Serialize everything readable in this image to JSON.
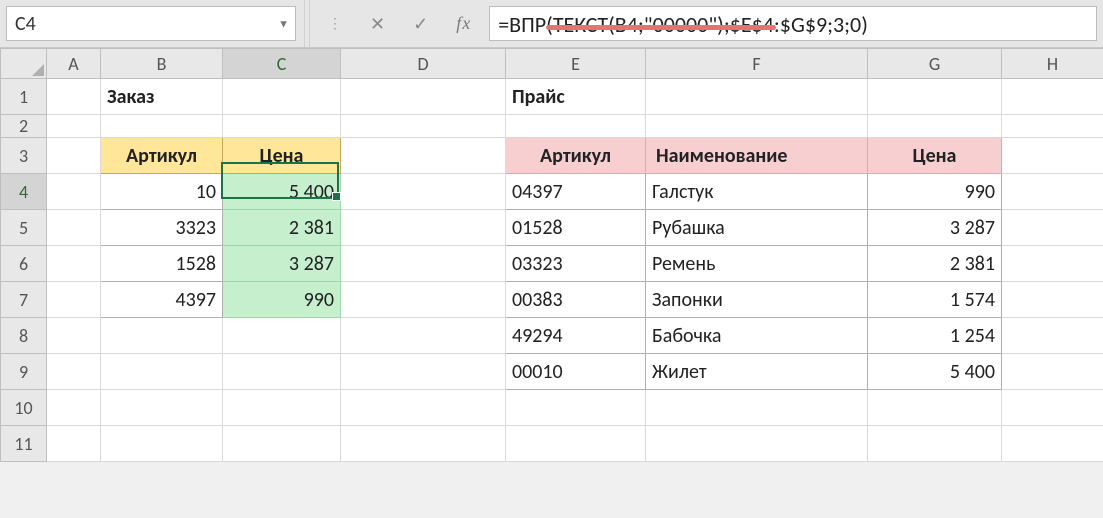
{
  "namebox": {
    "value": "C4"
  },
  "formula_bar": {
    "cancel_glyph": "✕",
    "confirm_glyph": "✓",
    "fx_label": "fx",
    "formula": "=ВПР(ТЕКСТ(B4;\"00000\");$E$4:$G$9;3;0)"
  },
  "columns": [
    "A",
    "B",
    "C",
    "D",
    "E",
    "F",
    "G",
    "H"
  ],
  "rows": [
    "1",
    "2",
    "3",
    "4",
    "5",
    "6",
    "7",
    "8",
    "9",
    "10",
    "11"
  ],
  "titles": {
    "order": "Заказ",
    "price": "Прайс"
  },
  "order_headers": {
    "sku": "Артикул",
    "price": "Цена"
  },
  "order_rows": [
    {
      "sku": "10",
      "price": "5 400"
    },
    {
      "sku": "3323",
      "price": "2 381"
    },
    {
      "sku": "1528",
      "price": "3 287"
    },
    {
      "sku": "4397",
      "price": "990"
    }
  ],
  "price_headers": {
    "sku": "Артикул",
    "name": "Наименование",
    "price": "Цена"
  },
  "price_rows": [
    {
      "sku": "04397",
      "name": "Галстук",
      "price": "990"
    },
    {
      "sku": "01528",
      "name": "Рубашка",
      "price": "3 287"
    },
    {
      "sku": "03323",
      "name": "Ремень",
      "price": "2 381"
    },
    {
      "sku": "00383",
      "name": "Запонки",
      "price": "1 574"
    },
    {
      "sku": "49294",
      "name": "Бабочка",
      "price": "1 254"
    },
    {
      "sku": "00010",
      "name": "Жилет",
      "price": "5 400"
    }
  ],
  "chart_data": {
    "type": "table",
    "tables": [
      {
        "title": "Заказ",
        "columns": [
          "Артикул",
          "Цена"
        ],
        "rows": [
          [
            10,
            5400
          ],
          [
            3323,
            2381
          ],
          [
            1528,
            3287
          ],
          [
            4397,
            990
          ]
        ]
      },
      {
        "title": "Прайс",
        "columns": [
          "Артикул",
          "Наименование",
          "Цена"
        ],
        "rows": [
          [
            "04397",
            "Галстук",
            990
          ],
          [
            "01528",
            "Рубашка",
            3287
          ],
          [
            "03323",
            "Ремень",
            2381
          ],
          [
            "00383",
            "Запонки",
            1574
          ],
          [
            "49294",
            "Бабочка",
            1254
          ],
          [
            "00010",
            "Жилет",
            5400
          ]
        ]
      }
    ]
  }
}
